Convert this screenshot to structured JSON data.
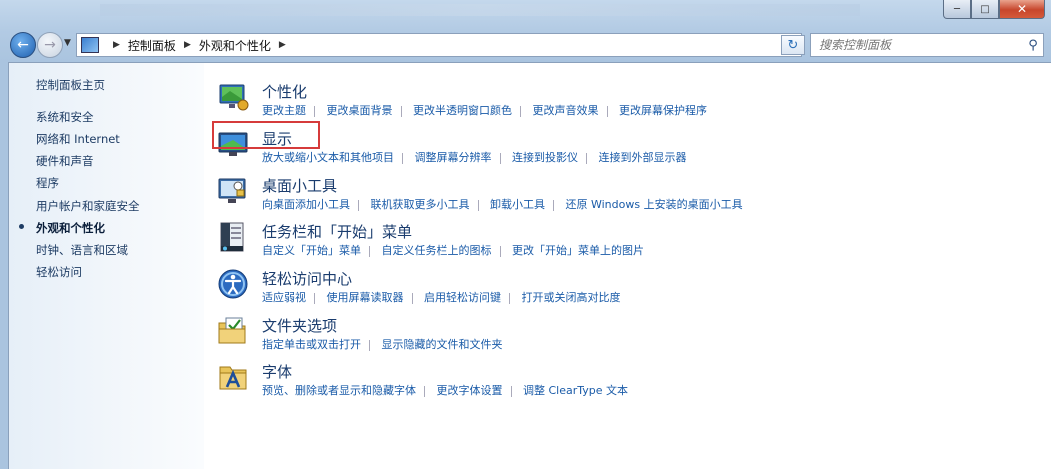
{
  "nav": {
    "breadcrumbs": [
      "控制面板",
      "外观和个性化"
    ],
    "search_placeholder": "搜索控制面板"
  },
  "sidebar": {
    "items": [
      {
        "label": "控制面板主页"
      },
      {
        "label": "系统和安全"
      },
      {
        "label": "网络和 Internet"
      },
      {
        "label": "硬件和声音"
      },
      {
        "label": "程序"
      },
      {
        "label": "用户帐户和家庭安全"
      },
      {
        "label": "外观和个性化",
        "active": true
      },
      {
        "label": "时钟、语言和区域"
      },
      {
        "label": "轻松访问"
      }
    ]
  },
  "categories": [
    {
      "title": "个性化",
      "icon": "personalization-icon",
      "links": [
        "更改主题",
        "更改桌面背景",
        "更改半透明窗口颜色",
        "更改声音效果",
        "更改屏幕保护程序"
      ]
    },
    {
      "title": "显示",
      "icon": "display-icon",
      "links": [
        "放大或缩小文本和其他项目",
        "调整屏幕分辨率",
        "连接到投影仪",
        "连接到外部显示器"
      ]
    },
    {
      "title": "桌面小工具",
      "icon": "gadgets-icon",
      "links": [
        "向桌面添加小工具",
        "联机获取更多小工具",
        "卸载小工具",
        "还原 Windows 上安装的桌面小工具"
      ]
    },
    {
      "title": "任务栏和「开始」菜单",
      "icon": "taskbar-icon",
      "links": [
        "自定义「开始」菜单",
        "自定义任务栏上的图标",
        "更改「开始」菜单上的图片"
      ]
    },
    {
      "title": "轻松访问中心",
      "icon": "ease-of-access-icon",
      "links": [
        "适应弱视",
        "使用屏幕读取器",
        "启用轻松访问键",
        "打开或关闭高对比度"
      ]
    },
    {
      "title": "文件夹选项",
      "icon": "folder-options-icon",
      "links": [
        "指定单击或双击打开",
        "显示隐藏的文件和文件夹"
      ]
    },
    {
      "title": "字体",
      "icon": "fonts-icon",
      "links": [
        "预览、删除或者显示和隐藏字体",
        "更改字体设置",
        "调整 ClearType 文本"
      ]
    }
  ],
  "colors": {
    "link": "#1a5ba8",
    "title": "#1a3c6e",
    "highlight": "#d63b3b"
  }
}
